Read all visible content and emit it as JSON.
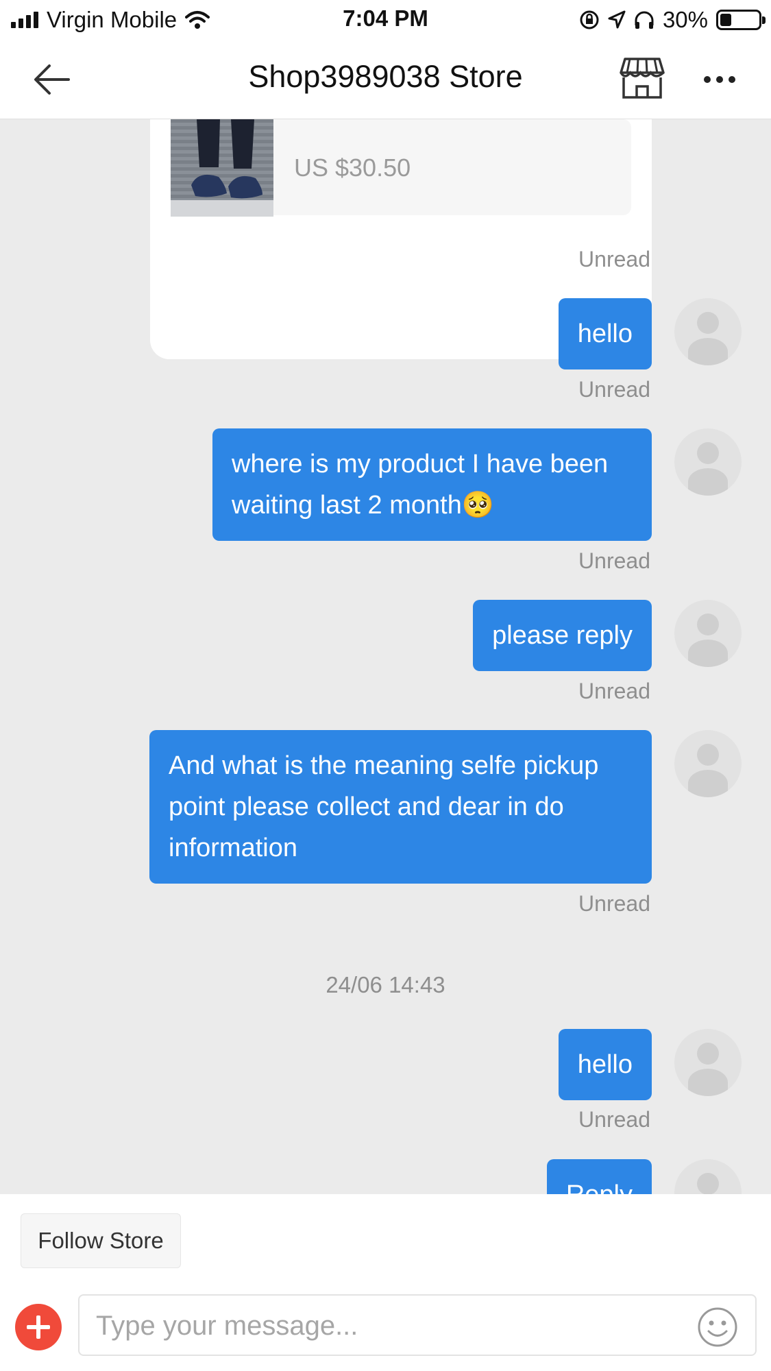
{
  "status_bar": {
    "carrier": "Virgin Mobile",
    "time": "7:04 PM",
    "battery": "30%",
    "battery_level": 0.3,
    "icons": [
      "signal-icon",
      "wifi-icon",
      "rotation-lock-icon",
      "location-icon",
      "headphones-icon",
      "battery-icon"
    ]
  },
  "header": {
    "title": "Shop3989038 Store",
    "icons": [
      "back-arrow-icon",
      "store-icon",
      "more-icon"
    ]
  },
  "product_card": {
    "price": "US $30.50"
  },
  "messages": [
    {
      "text": "hello",
      "status": "Unread"
    },
    {
      "text": "where is my product I have been waiting last 2 month🥺",
      "status": "Unread"
    },
    {
      "text": "please reply",
      "status": "Unread"
    },
    {
      "text": "And what is the meaning  selfe pickup point please collect and dear in do information",
      "status": "Unread"
    },
    {
      "text": "hello",
      "status": "Unread"
    },
    {
      "text": "Reply"
    }
  ],
  "product_status": "Unread",
  "timestamp": "24/06 14:43",
  "bottom_bar": {
    "follow_label": "Follow Store",
    "input_placeholder": "Type your message...",
    "icons": [
      "add-icon",
      "emoji-icon"
    ]
  },
  "colors": {
    "bubble": "#2d86e5",
    "add_button": "#f04a3a",
    "background": "#ebebeb"
  }
}
